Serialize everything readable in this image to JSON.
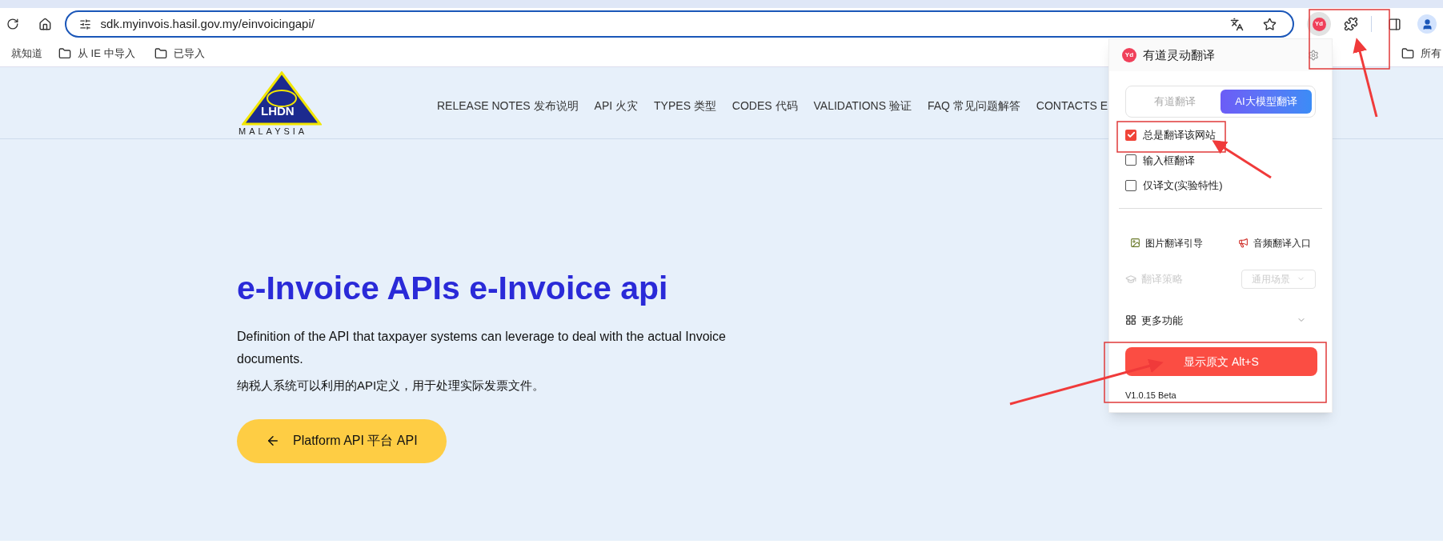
{
  "browser": {
    "url": "sdk.myinvois.hasil.gov.my/einvoicingapi/",
    "extension_badge": "Yd",
    "bookmarks": [
      "就知道",
      "从 IE 中导入",
      "已导入"
    ],
    "bookmarks_right": "所有"
  },
  "site": {
    "logo": {
      "text": "LHDN",
      "subtitle": "MALAYSIA"
    },
    "nav": [
      "RELEASE NOTES 发布说明",
      "API 火灾",
      "TYPES 类型",
      "CODES 代码",
      "VALIDATIONS 验证",
      "FAQ 常见问题解答",
      "CONTACTS E"
    ],
    "hero": {
      "title": "e-Invoice APIs e-Invoice api",
      "description": "Definition of the API that taxpayer systems can leverage to deal with the actual Invoice documents.",
      "description_zh": "纳税人系统可以利用的API定义，用于处理实际发票文件。",
      "button": "Platform API 平台 API"
    }
  },
  "popup": {
    "logo_text": "Yd",
    "title": "有道灵动翻译",
    "tabs": [
      {
        "label": "有道翻译",
        "selected": false
      },
      {
        "label": "AI大模型翻译",
        "selected": true
      }
    ],
    "options": [
      {
        "label": "总是翻译该网站",
        "checked": true
      },
      {
        "label": "输入框翻译",
        "checked": false
      },
      {
        "label": "仅译文(实验特性)",
        "checked": false
      }
    ],
    "links": [
      {
        "kind": "picture",
        "label": "图片翻译引导"
      },
      {
        "kind": "audio",
        "label": "音频翻译入口"
      }
    ],
    "strategy": {
      "label": "翻译策略",
      "value": "通用场景",
      "disabled": true
    },
    "more": "更多功能",
    "action": "显示原文 Alt+S",
    "version": "V1.0.15 Beta"
  }
}
